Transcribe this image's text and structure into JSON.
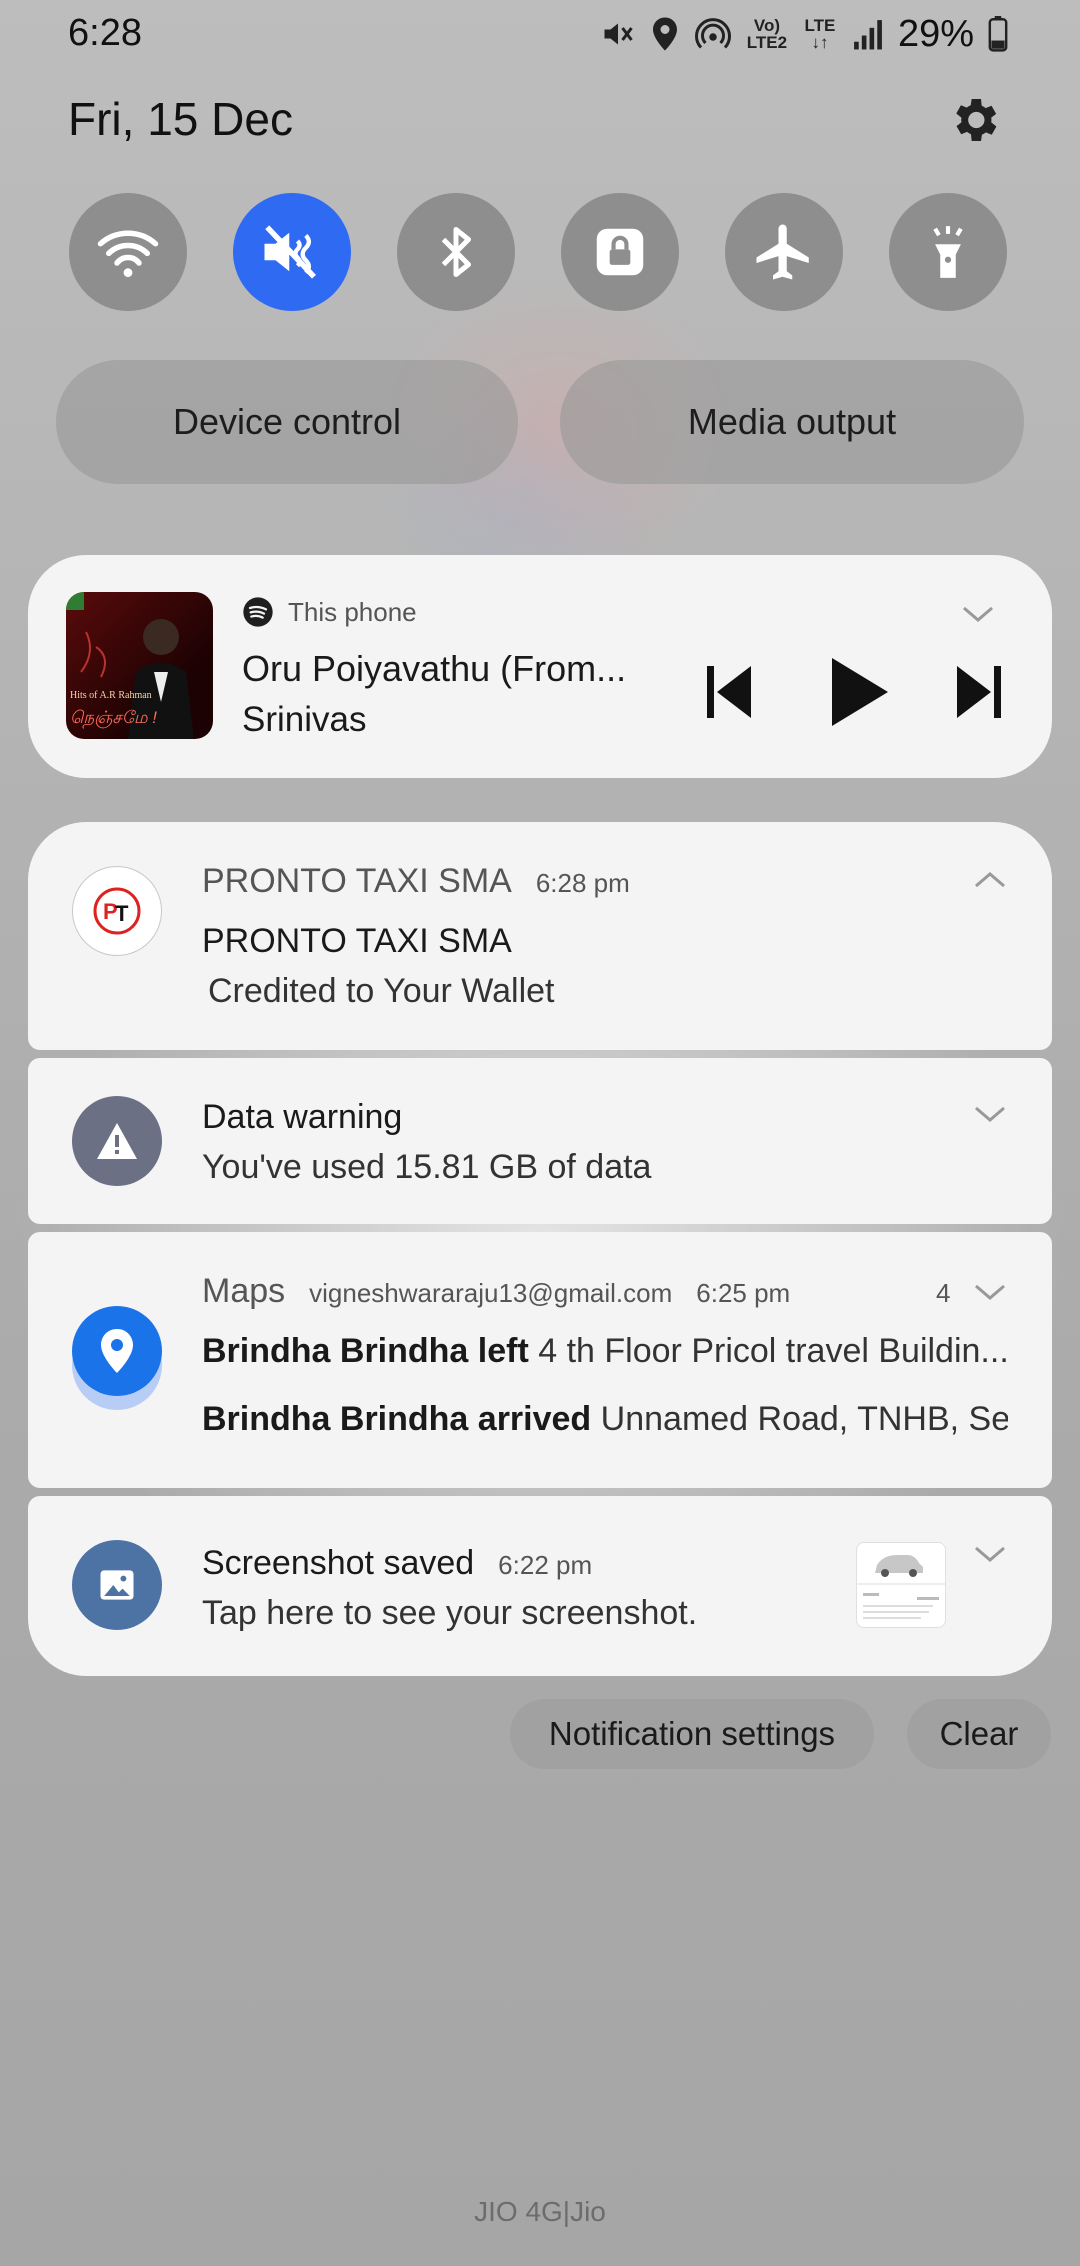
{
  "status_bar": {
    "time": "6:28",
    "battery": "29%",
    "icons": [
      "mute-icon",
      "location-icon",
      "hotspot-icon",
      "volte-icon",
      "lte-icon",
      "signal-icon",
      "battery-icon"
    ],
    "volte_label": "Vo) LTE2",
    "lte_label": "LTE"
  },
  "header": {
    "date": "Fri, 15 Dec"
  },
  "quick_toggles": [
    {
      "name": "wifi",
      "icon": "wifi-icon",
      "active": false
    },
    {
      "name": "mute",
      "icon": "mute-icon",
      "active": true
    },
    {
      "name": "bluetooth",
      "icon": "bluetooth-icon",
      "active": false
    },
    {
      "name": "rotation-lock",
      "icon": "lock-icon",
      "active": false
    },
    {
      "name": "airplane",
      "icon": "airplane-icon",
      "active": false
    },
    {
      "name": "flashlight",
      "icon": "flashlight-icon",
      "active": false
    }
  ],
  "pills": {
    "device_control": "Device control",
    "media_output": "Media output"
  },
  "media": {
    "source": "This phone",
    "title": "Oru Poiyavathu (From...",
    "artist": "Srinivas",
    "album_text": "Hits of A.R Rahman",
    "album_tamil": "நெஞ்சமே !"
  },
  "notifications": {
    "pronto": {
      "app": "PRONTO TAXI SMA",
      "time": "6:28 pm",
      "title": "PRONTO TAXI SMA",
      "text": "Credited to Your Wallet"
    },
    "data": {
      "title": "Data warning",
      "text": "You've used 15.81 GB of data"
    },
    "maps": {
      "app": "Maps",
      "account": "vigneshwararaju13@gmail.com",
      "time": "6:25 pm",
      "count": "4",
      "line1_bold": "Brindha Brindha left",
      "line1_text": "4 th Floor Pricol travel Buildin...",
      "line2_bold": "Brindha Brindha arrived",
      "line2_text": "Unnamed Road, TNHB, Se..."
    },
    "screenshot": {
      "title": "Screenshot saved",
      "time": "6:22 pm",
      "text": "Tap here to see your screenshot."
    }
  },
  "actions": {
    "settings": "Notification settings",
    "clear": "Clear"
  },
  "carrier": "JIO 4G|Jio",
  "colors": {
    "accent": "#2f6bf2",
    "maps_blue": "#1a73e8",
    "card": "#f4f4f4"
  }
}
